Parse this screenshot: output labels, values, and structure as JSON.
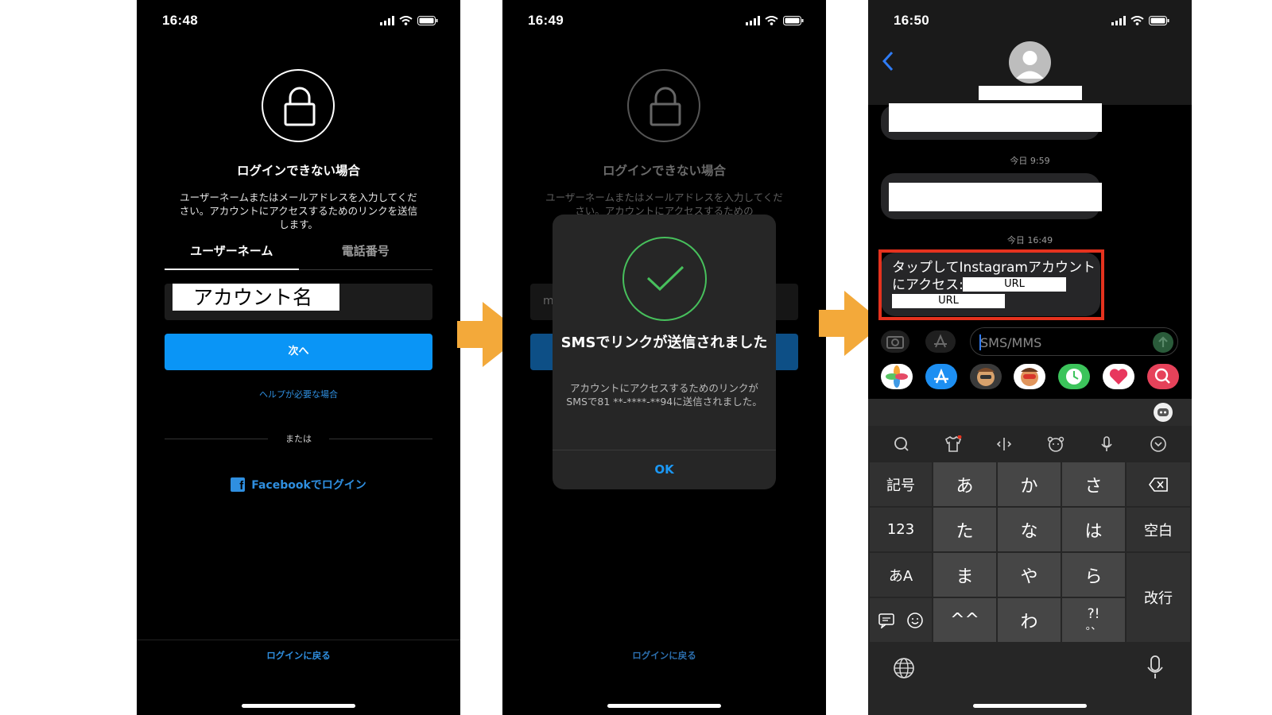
{
  "screens": [
    {
      "time": "16:48",
      "title": "ログインできない場合",
      "description": "ユーザーネームまたはメールアドレスを入力してください。アカウントにアクセスするためのリンクを送信します。",
      "tabs": [
        "ユーザーネーム",
        "電話番号"
      ],
      "field_value": "アカウント名",
      "next_button": "次へ",
      "help_link": "ヘルプが必要な場合",
      "or_text": "または",
      "facebook_login": "Facebookでログイン",
      "back_to_login": "ログインに戻る"
    },
    {
      "time": "16:49",
      "title": "ログインできない場合",
      "description": "ユーザーネームまたはメールアドレスを入力してください。アカウントにアクセスするための",
      "field_value_partial": "m",
      "dialog": {
        "title": "SMSでリンクが送信されました",
        "message": "アカウントにアクセスするためのリンクがSMSで81 **-****-**94に送信されました。",
        "ok_button": "OK"
      },
      "back_to_login": "ログインに戻る"
    },
    {
      "time": "16:50",
      "timestamps": [
        "今日 9:59",
        "今日 16:49"
      ],
      "sms_text": "タップしてInstagramアカウントにアクセス:",
      "url_label_1": "URL",
      "url_label_2": "URL",
      "input_placeholder": "SMS/MMS",
      "keyboard": {
        "side_left": [
          "記号",
          "123",
          "あA"
        ],
        "kana": [
          "あ",
          "か",
          "さ",
          "た",
          "な",
          "は",
          "ま",
          "や",
          "ら",
          "^^",
          "わ",
          "?!"
        ],
        "kana_last_sub": "。、",
        "space": "空白",
        "enter": "改行"
      }
    }
  ],
  "colors": {
    "instagram_blue": "#0a95f6",
    "link_blue": "#2f8fe0",
    "success_green": "#47c05c",
    "highlight_red": "#e5321e",
    "arrow_orange": "#f3a93a"
  }
}
